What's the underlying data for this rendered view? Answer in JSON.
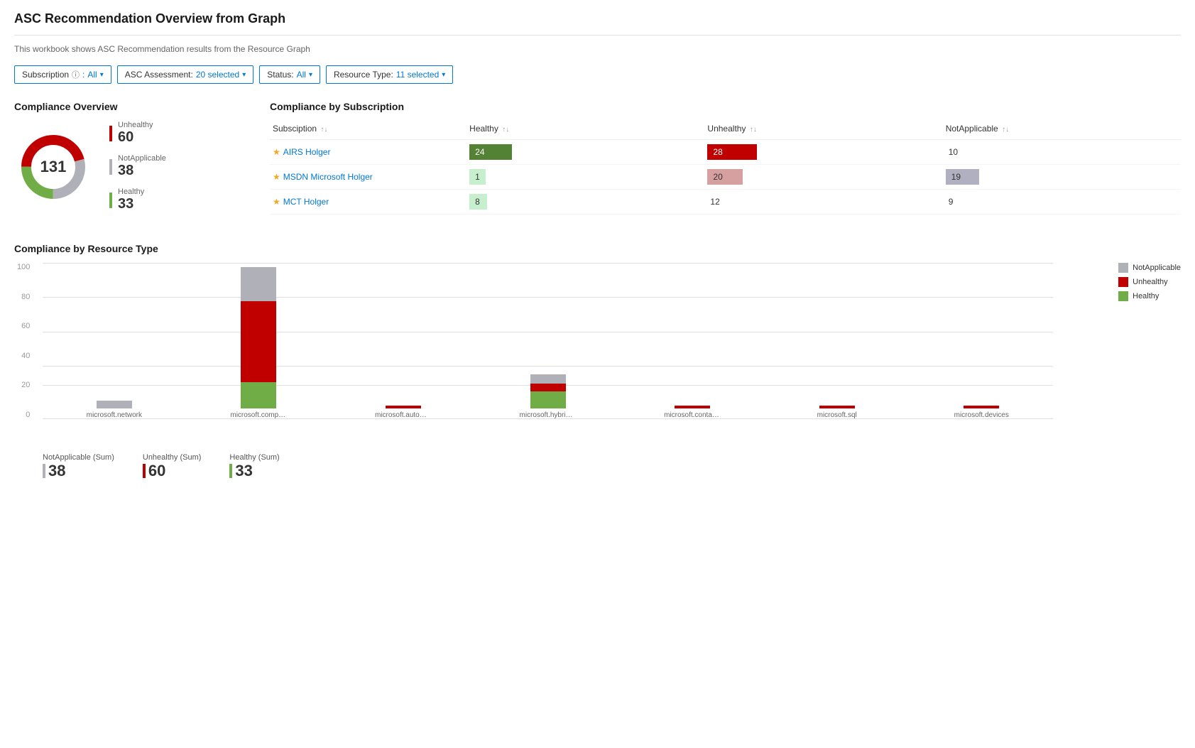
{
  "page": {
    "title": "ASC Recommendation Overview from Graph",
    "subtitle": "This workbook shows ASC Recommendation results from the Resource Graph"
  },
  "filters": {
    "subscription": {
      "label": "Subscription",
      "info": "ⓘ",
      "value": "All"
    },
    "asc_assessment": {
      "label": "ASC Assessment:",
      "value": "20 selected"
    },
    "status": {
      "label": "Status:",
      "value": "All"
    },
    "resource_type": {
      "label": "Resource Type:",
      "value": "11 selected"
    }
  },
  "compliance_overview": {
    "title": "Compliance Overview",
    "total": "131",
    "segments": [
      {
        "label": "Unhealthy",
        "value": "60",
        "color": "#c00000",
        "percent": 46
      },
      {
        "label": "NotApplicable",
        "value": "38",
        "color": "#b0b0b8",
        "percent": 29
      },
      {
        "label": "Healthy",
        "value": "33",
        "color": "#70ad47",
        "percent": 25
      }
    ]
  },
  "compliance_subscription": {
    "title": "Compliance by Subscription",
    "columns": [
      "Subsciption",
      "Healthy",
      "Unhealthy",
      "NotApplicable"
    ],
    "rows": [
      {
        "name": "AIRS Holger",
        "healthy": 24,
        "unhealthy": 28,
        "not_applicable": 10,
        "healthy_bar_width": 120,
        "unhealthy_bar_width": 140,
        "na_bar_width": 0,
        "healthy_style": "bar-green",
        "unhealthy_style": "bar-red",
        "na_plain": true
      },
      {
        "name": "MSDN Microsoft Holger",
        "healthy": 1,
        "unhealthy": 20,
        "not_applicable": 19,
        "healthy_bar_width": 20,
        "unhealthy_bar_width": 100,
        "na_bar_width": 95,
        "healthy_style": "bar-light-green",
        "unhealthy_style": "bar-pink",
        "na_plain": false
      },
      {
        "name": "MCT Holger",
        "healthy": 8,
        "unhealthy": 12,
        "not_applicable": 9,
        "healthy_bar_width": 50,
        "unhealthy_bar_width": 0,
        "na_bar_width": 0,
        "healthy_style": "bar-light-green",
        "unhealthy_style": "",
        "na_plain": true
      }
    ]
  },
  "compliance_resource_type": {
    "title": "Compliance by Resource Type",
    "legend": [
      {
        "label": "NotApplicable",
        "color": "#b0b0b8"
      },
      {
        "label": "Unhealthy",
        "color": "#c00000"
      },
      {
        "label": "Healthy",
        "color": "#70ad47"
      }
    ],
    "y_labels": [
      "100",
      "80",
      "60",
      "40",
      "20",
      "0"
    ],
    "bars": [
      {
        "label": "microsoft.network",
        "healthy": 0,
        "unhealthy": 0,
        "not_applicable": 5,
        "total_height": 5
      },
      {
        "label": "microsoft.compute",
        "healthy": 17,
        "unhealthy": 52,
        "not_applicable": 22,
        "total_height": 91
      },
      {
        "label": "microsoft.automation",
        "healthy": 0,
        "unhealthy": 2,
        "not_applicable": 0,
        "total_height": 2
      },
      {
        "label": "microsoft.hybridcompute",
        "healthy": 11,
        "unhealthy": 5,
        "not_applicable": 6,
        "total_height": 22
      },
      {
        "label": "microsoft.containerregistry",
        "healthy": 0,
        "unhealthy": 2,
        "not_applicable": 0,
        "total_height": 2
      },
      {
        "label": "microsoft.sql",
        "healthy": 0,
        "unhealthy": 2,
        "not_applicable": 0,
        "total_height": 2
      },
      {
        "label": "microsoft.devices",
        "healthy": 0,
        "unhealthy": 2,
        "not_applicable": 0,
        "total_height": 2
      }
    ]
  },
  "bottom_summary": {
    "not_applicable_label": "NotApplicable (Sum)",
    "not_applicable_value": "38",
    "unhealthy_label": "Unhealthy (Sum)",
    "unhealthy_value": "60",
    "healthy_label": "Healthy (Sum)",
    "healthy_value": "33"
  },
  "detection": {
    "unhealthy_label": "Unhealthy"
  }
}
